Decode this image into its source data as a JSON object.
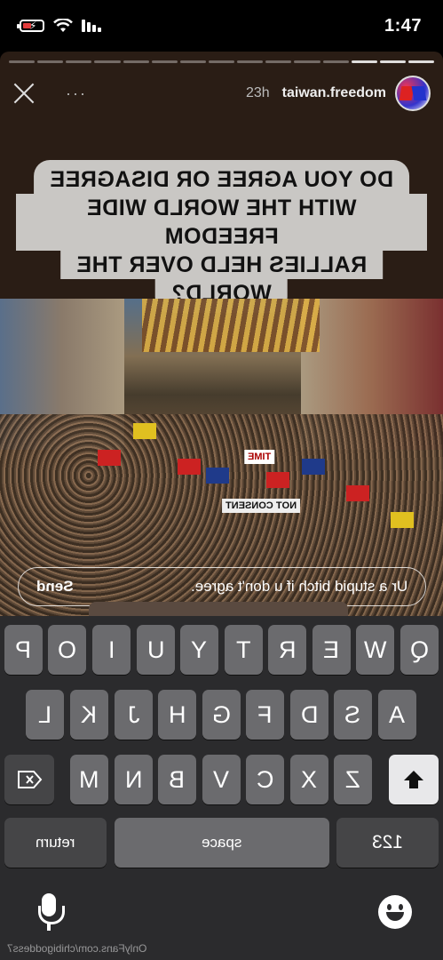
{
  "status_bar": {
    "time": "1:47"
  },
  "story": {
    "username": "taiwan.freedom",
    "time_ago": "23h",
    "more": "···",
    "question_lines": [
      "DO YOU AGREE OR DISAGREE",
      "WITH THE WORLD WIDE FREEDOM",
      "RALLIES HELD OVER THE",
      "WORLD?"
    ],
    "photo_signs": [
      "NOT CONSENT",
      "TIME"
    ]
  },
  "reply": {
    "text": "Ur a stupid bitch if u don't agree.",
    "send_label": "Send"
  },
  "keyboard": {
    "row1": [
      "P",
      "O",
      "I",
      "U",
      "Y",
      "T",
      "R",
      "E",
      "W",
      "Q"
    ],
    "row2": [
      "L",
      "K",
      "J",
      "H",
      "G",
      "F",
      "D",
      "S",
      "A"
    ],
    "row3": [
      "M",
      "N",
      "B",
      "V",
      "C",
      "X",
      "Z"
    ],
    "return_label": "return",
    "space_label": "space",
    "numbers_label": "123"
  },
  "watermark": "OnlyFans.com/chibigoddess7",
  "colors": {
    "story_bg": "#2a1d15",
    "keyboard_bg": "#2b2b2d",
    "key": "#6b6b6e",
    "question_bubble": "#c9c7c4"
  }
}
